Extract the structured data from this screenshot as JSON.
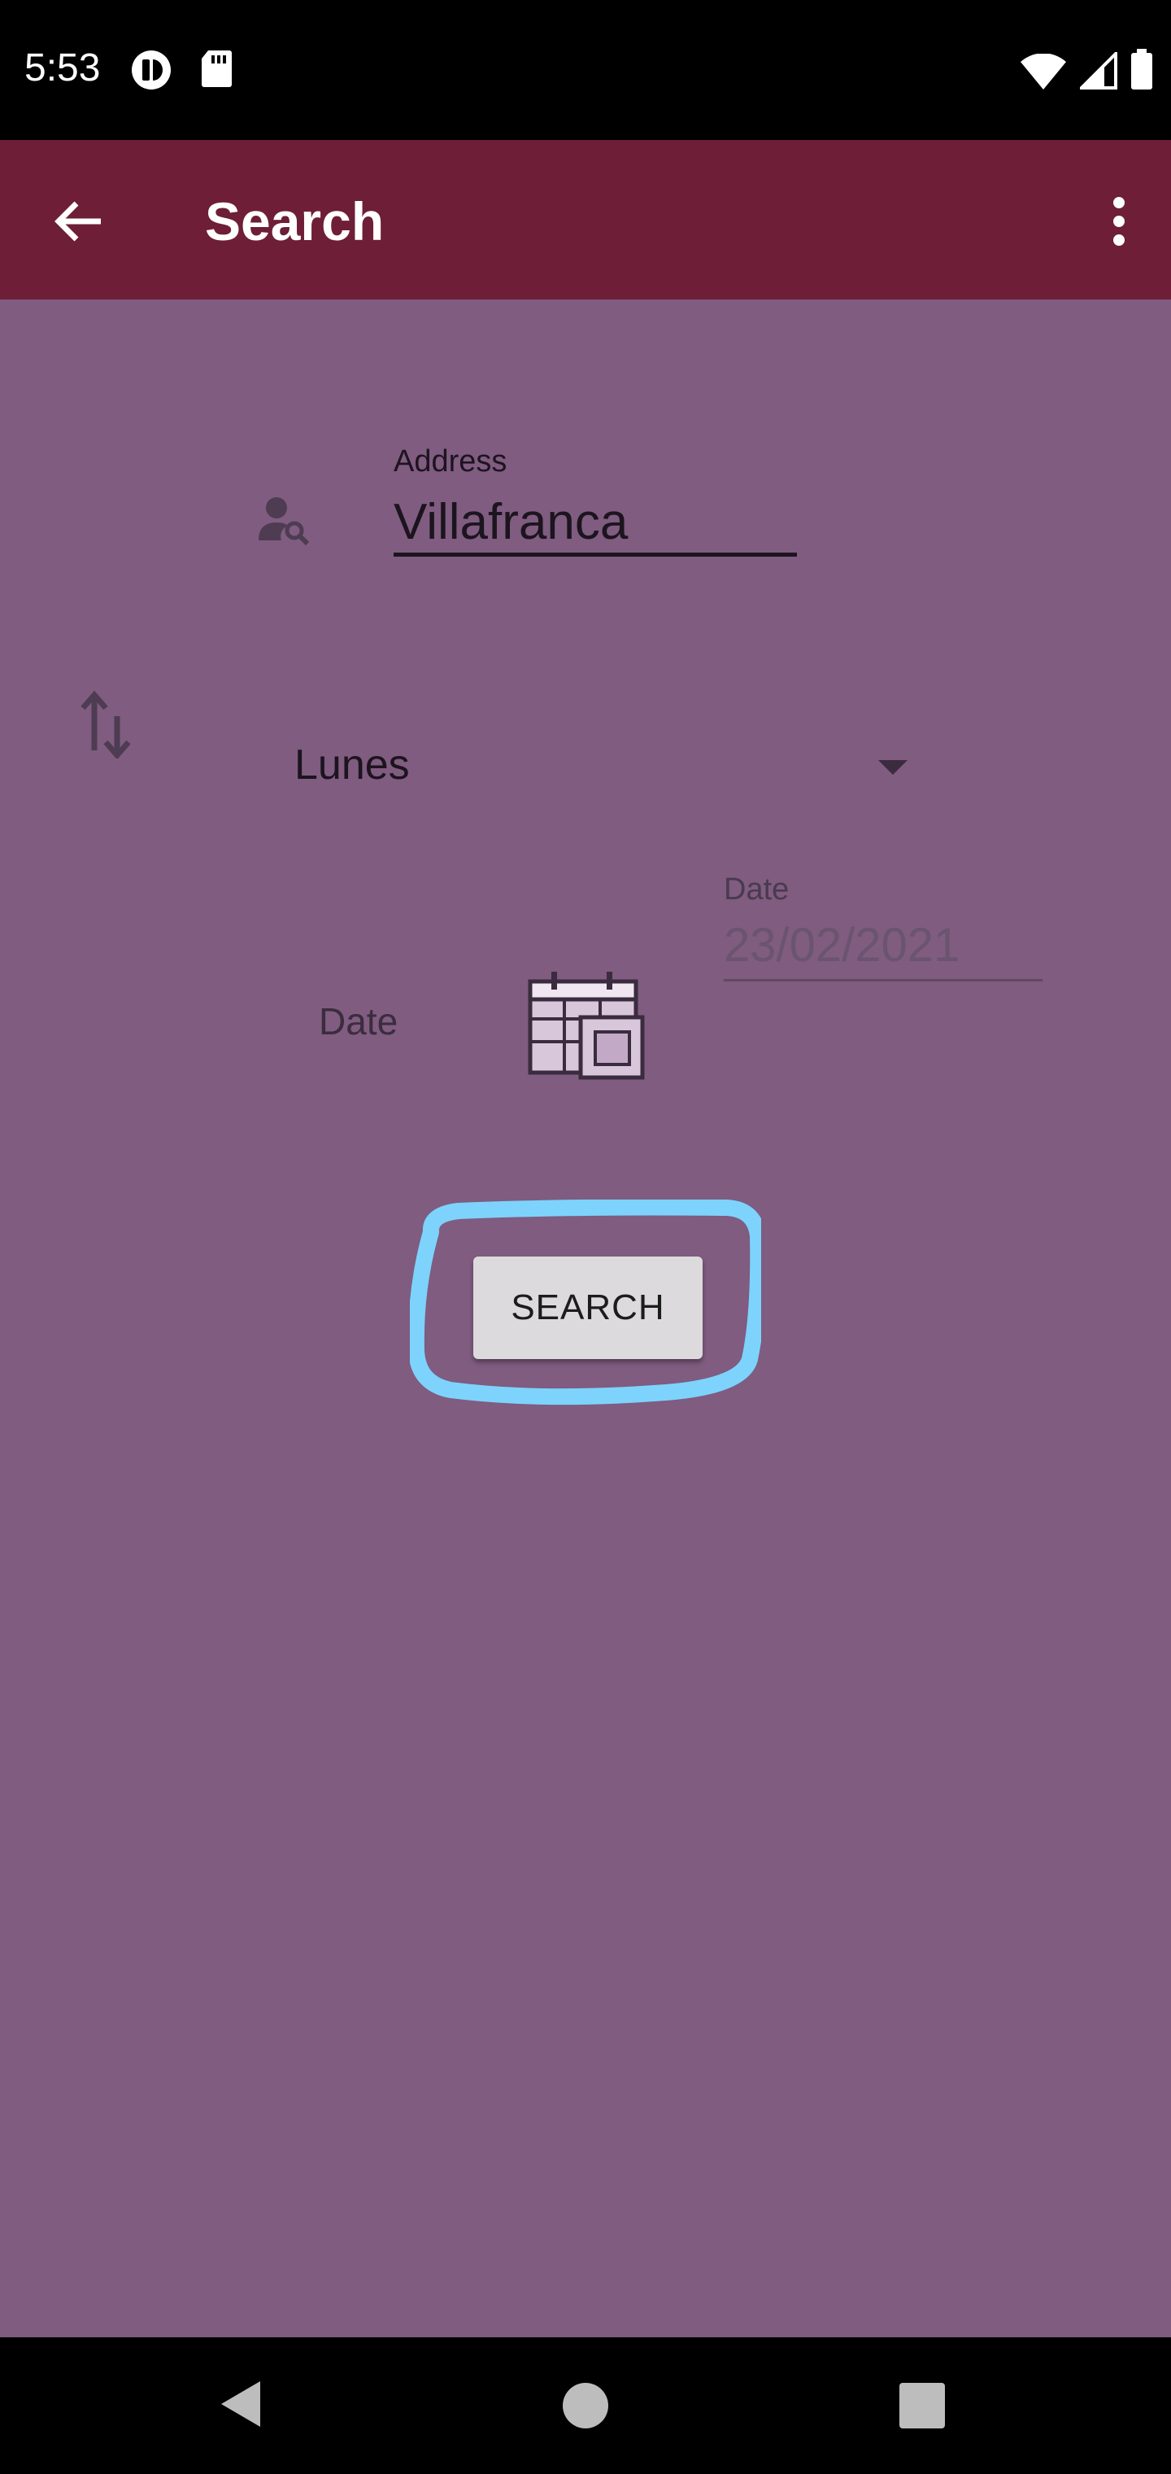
{
  "status_bar": {
    "time": "5:53",
    "icons": [
      "notification-app-icon",
      "sd-card-icon",
      "wifi-icon",
      "cell-signal-icon",
      "battery-icon"
    ]
  },
  "app_bar": {
    "title": "Search",
    "background": "#6e1e37",
    "icons": [
      "back-arrow-icon",
      "overflow-menu-icon"
    ]
  },
  "form": {
    "background": "#7f5c80",
    "address": {
      "label": "Address",
      "value": "Villafranca",
      "icon": "person-search-icon"
    },
    "day_select": {
      "value": "Lunes",
      "icon": "swap-vertical-icon"
    },
    "date": {
      "label": "Date",
      "field_label": "Date",
      "field_value": "23/02/2021",
      "icon": "calendar-icon"
    },
    "search_button": {
      "label": "SEARCH"
    },
    "highlight_color": "#7dd3fc"
  },
  "nav_bar": {
    "icons": [
      "nav-back-icon",
      "nav-home-icon",
      "nav-recents-icon"
    ]
  }
}
